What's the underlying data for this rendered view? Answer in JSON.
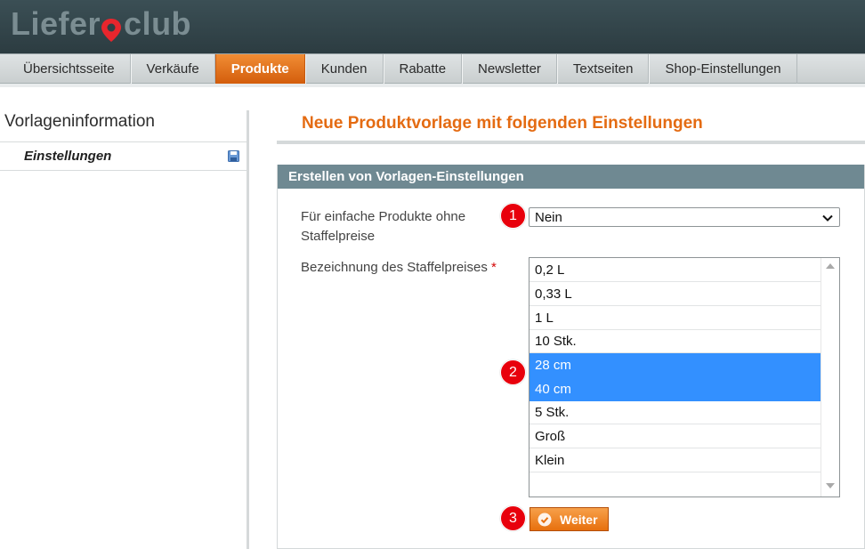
{
  "header": {
    "logo_left": "Liefer",
    "logo_right": "club"
  },
  "nav": {
    "items": [
      {
        "label": "Übersichtsseite"
      },
      {
        "label": "Verkäufe"
      },
      {
        "label": "Produkte",
        "active": true
      },
      {
        "label": "Kunden"
      },
      {
        "label": "Rabatte"
      },
      {
        "label": "Newsletter"
      },
      {
        "label": "Textseiten"
      },
      {
        "label": "Shop-Einstellungen"
      }
    ]
  },
  "sidebar": {
    "title": "Vorlageninformation",
    "items": [
      {
        "label": "Einstellungen",
        "icon": "save-icon"
      }
    ]
  },
  "main": {
    "title": "Neue Produktvorlage mit folgenden Einstellungen",
    "section_title": "Erstellen von Vorlagen-Einstellungen",
    "field1": {
      "label_line1": "Für einfache Produkte ohne",
      "label_line2": "Staffelpreise",
      "value": "Nein"
    },
    "field2": {
      "label": "Bezeichnung des Staffelpreises",
      "required_mark": "*",
      "options": [
        {
          "label": "0,2 L",
          "selected": false
        },
        {
          "label": "0,33 L",
          "selected": false
        },
        {
          "label": "1 L",
          "selected": false
        },
        {
          "label": "10 Stk.",
          "selected": false
        },
        {
          "label": "28 cm",
          "selected": true
        },
        {
          "label": "40 cm",
          "selected": true
        },
        {
          "label": "5 Stk.",
          "selected": false
        },
        {
          "label": "Groß",
          "selected": false
        },
        {
          "label": "Klein",
          "selected": false
        }
      ]
    },
    "submit_label": "Weiter",
    "badges": [
      "1",
      "2",
      "3"
    ]
  },
  "colors": {
    "accent": "#e46b12",
    "nav_active": "#e8761a",
    "section_head": "#6f8992",
    "selection": "#3390ff",
    "badge": "#e8000c"
  }
}
